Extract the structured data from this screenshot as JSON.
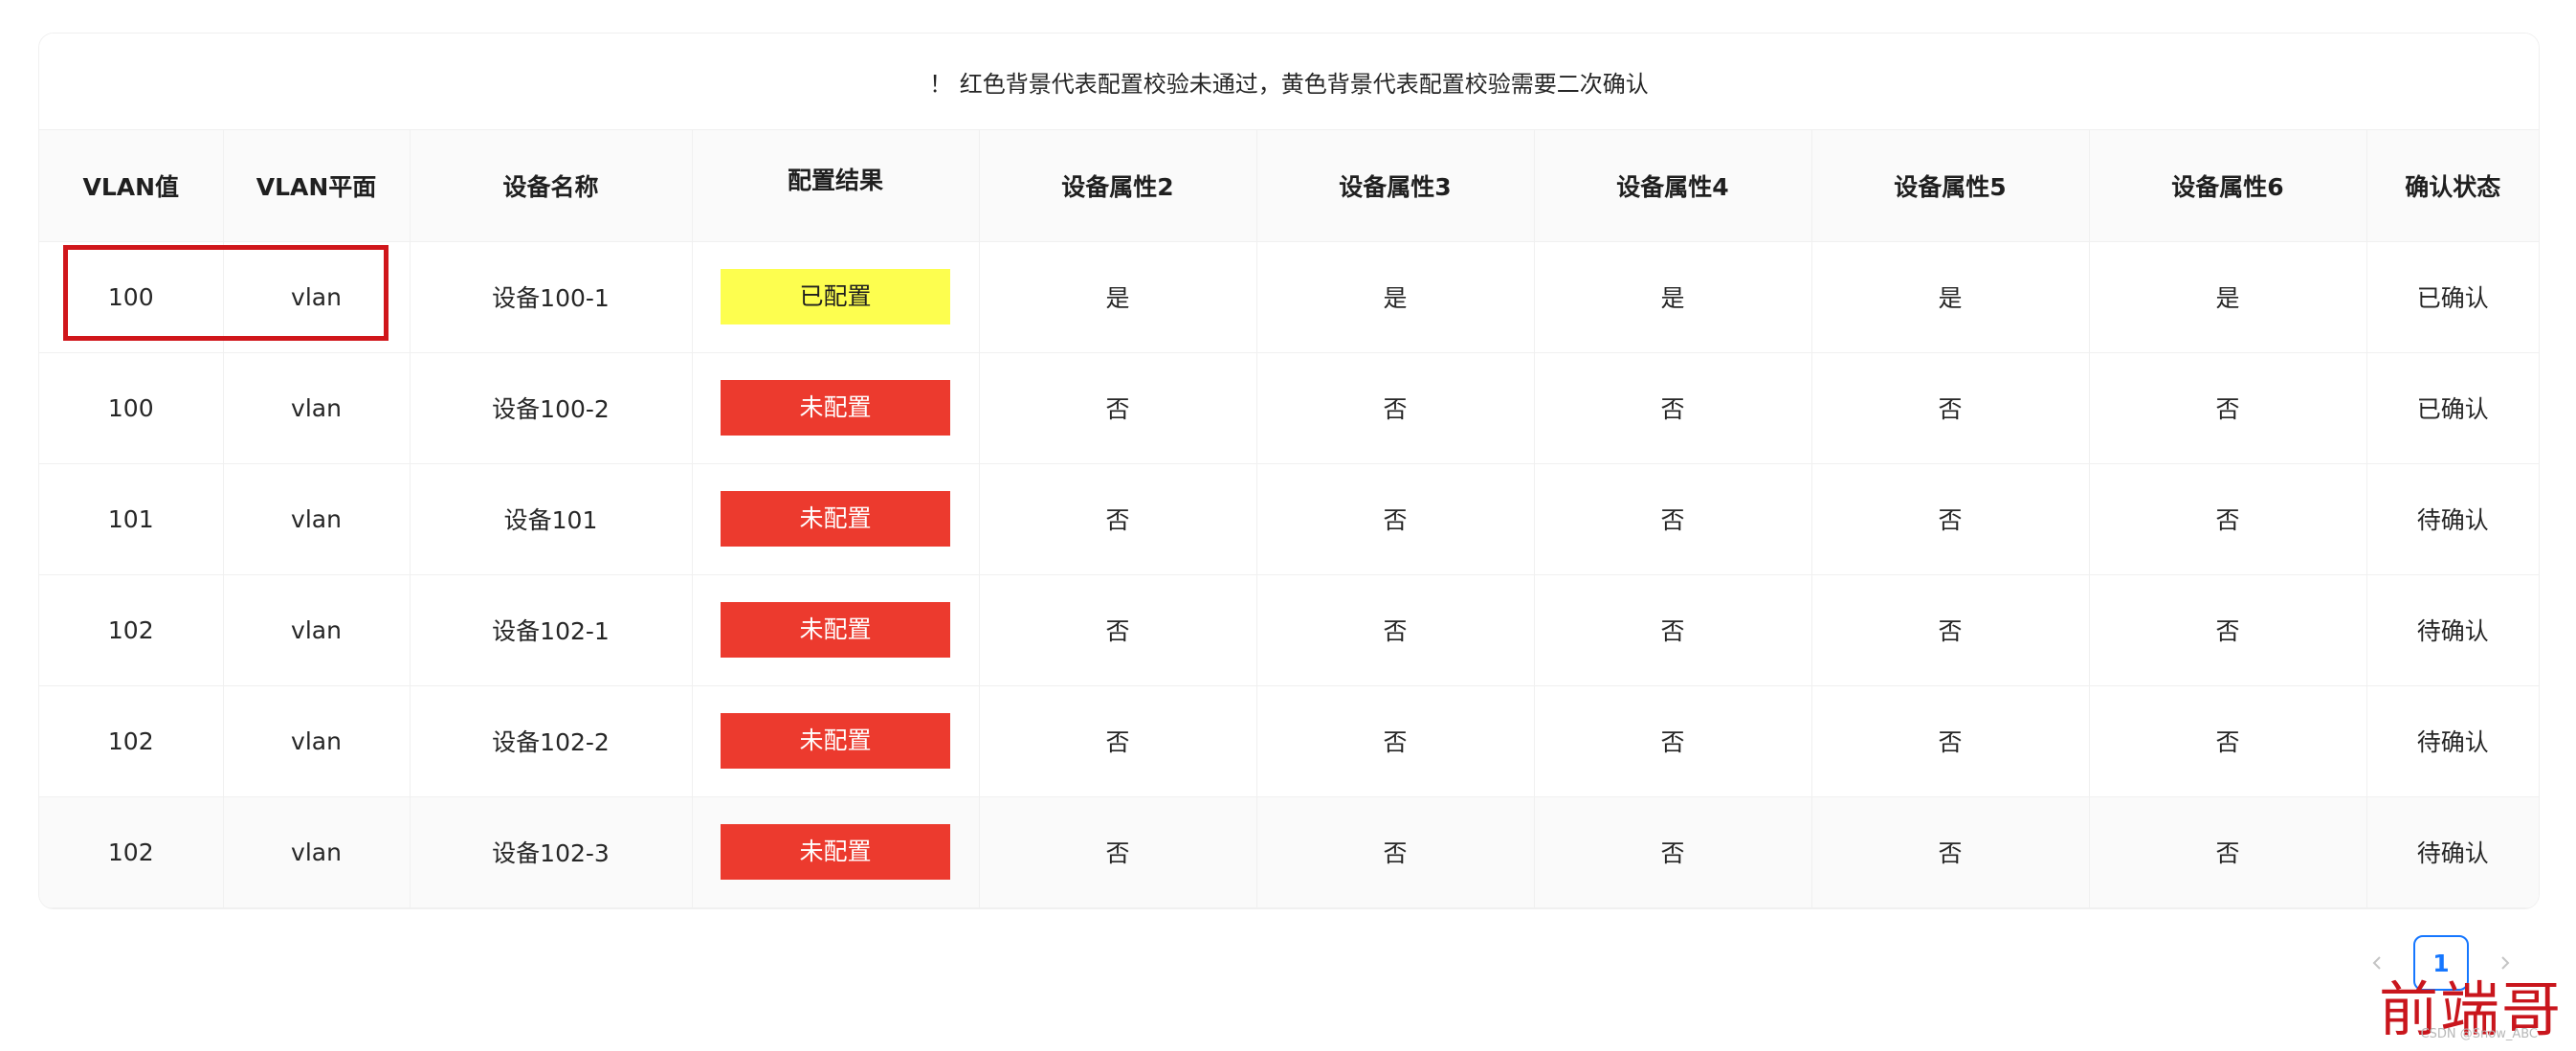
{
  "notice": "！ 红色背景代表配置校验未通过，黄色背景代表配置校验需要二次确认",
  "columns": [
    "VLAN值",
    "VLAN平面",
    "设备名称",
    "配置结果",
    "设备属性2",
    "设备属性3",
    "设备属性4",
    "设备属性5",
    "设备属性6",
    "确认状态"
  ],
  "rows": [
    {
      "vlan": "100",
      "plane": "vlan",
      "device": "设备100-1",
      "result": "已配置",
      "result_status": "warning",
      "attr2": "是",
      "attr3": "是",
      "attr4": "是",
      "attr5": "是",
      "attr6": "是",
      "confirm": "已确认"
    },
    {
      "vlan": "100",
      "plane": "vlan",
      "device": "设备100-2",
      "result": "未配置",
      "result_status": "error",
      "attr2": "否",
      "attr3": "否",
      "attr4": "否",
      "attr5": "否",
      "attr6": "否",
      "confirm": "已确认"
    },
    {
      "vlan": "101",
      "plane": "vlan",
      "device": "设备101",
      "result": "未配置",
      "result_status": "error",
      "attr2": "否",
      "attr3": "否",
      "attr4": "否",
      "attr5": "否",
      "attr6": "否",
      "confirm": "待确认"
    },
    {
      "vlan": "102",
      "plane": "vlan",
      "device": "设备102-1",
      "result": "未配置",
      "result_status": "error",
      "attr2": "否",
      "attr3": "否",
      "attr4": "否",
      "attr5": "否",
      "attr6": "否",
      "confirm": "待确认"
    },
    {
      "vlan": "102",
      "plane": "vlan",
      "device": "设备102-2",
      "result": "未配置",
      "result_status": "error",
      "attr2": "否",
      "attr3": "否",
      "attr4": "否",
      "attr5": "否",
      "attr6": "否",
      "confirm": "待确认"
    },
    {
      "vlan": "102",
      "plane": "vlan",
      "device": "设备102-3",
      "result": "未配置",
      "result_status": "error",
      "attr2": "否",
      "attr3": "否",
      "attr4": "否",
      "attr5": "否",
      "attr6": "否",
      "confirm": "待确认"
    }
  ],
  "pagination": {
    "prev_icon": "chevron-left-icon",
    "current_page": "1",
    "next_icon": "chevron-right-icon"
  },
  "colors": {
    "error_bg": "#ec3a2e",
    "warning_bg": "#fdfe4f",
    "highlight_border": "#d0161b",
    "accent": "#1677ff"
  },
  "watermark": {
    "text": "前端哥",
    "small": "CSDN @Snow_ABC"
  }
}
